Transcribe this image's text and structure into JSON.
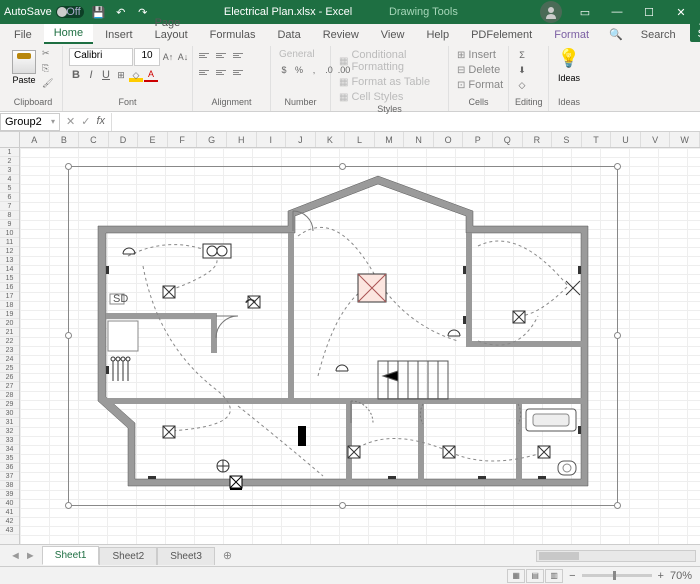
{
  "titlebar": {
    "autosave_label": "AutoSave",
    "autosave_state": "Off",
    "filename": "Electrical Plan.xlsx - Excel",
    "context_tools": "Drawing Tools"
  },
  "tabs": {
    "items": [
      "File",
      "Home",
      "Insert",
      "Page Layout",
      "Formulas",
      "Data",
      "Review",
      "View",
      "Help",
      "PDFelement"
    ],
    "context_tab": "Format",
    "active": "Home",
    "search_label": "Search",
    "share_label": "Share"
  },
  "ribbon": {
    "clipboard": {
      "label": "Clipboard",
      "paste": "Paste"
    },
    "font": {
      "label": "Font",
      "name": "Calibri",
      "size": "10"
    },
    "alignment": {
      "label": "Alignment"
    },
    "number": {
      "label": "Number",
      "format": "General"
    },
    "styles": {
      "label": "Styles",
      "cond": "Conditional Formatting",
      "table": "Format as Table",
      "cell": "Cell Styles"
    },
    "cells": {
      "label": "Cells",
      "insert": "Insert",
      "delete": "Delete",
      "format": "Format"
    },
    "editing": {
      "label": "Editing"
    },
    "ideas": {
      "label": "Ideas",
      "btn": "Ideas"
    }
  },
  "namebox": "Group2",
  "columns": [
    "A",
    "B",
    "C",
    "D",
    "E",
    "F",
    "G",
    "H",
    "I",
    "J",
    "K",
    "L",
    "M",
    "N",
    "O",
    "P",
    "Q",
    "R",
    "S",
    "T",
    "U",
    "V",
    "W"
  ],
  "rows": [
    "1",
    "2",
    "3",
    "4",
    "5",
    "6",
    "7",
    "8",
    "9",
    "10",
    "11",
    "12",
    "13",
    "14",
    "15",
    "16",
    "17",
    "18",
    "19",
    "20",
    "21",
    "22",
    "23",
    "24",
    "25",
    "26",
    "27",
    "28",
    "29",
    "30",
    "31",
    "32",
    "33",
    "34",
    "35",
    "36",
    "37",
    "38",
    "39",
    "40",
    "41",
    "42",
    "43"
  ],
  "sheets": {
    "items": [
      "Sheet1",
      "Sheet2",
      "Sheet3"
    ],
    "active": "Sheet1"
  },
  "statusbar": {
    "zoom": "70%"
  },
  "floorplan": {
    "label_sd": "SD"
  }
}
